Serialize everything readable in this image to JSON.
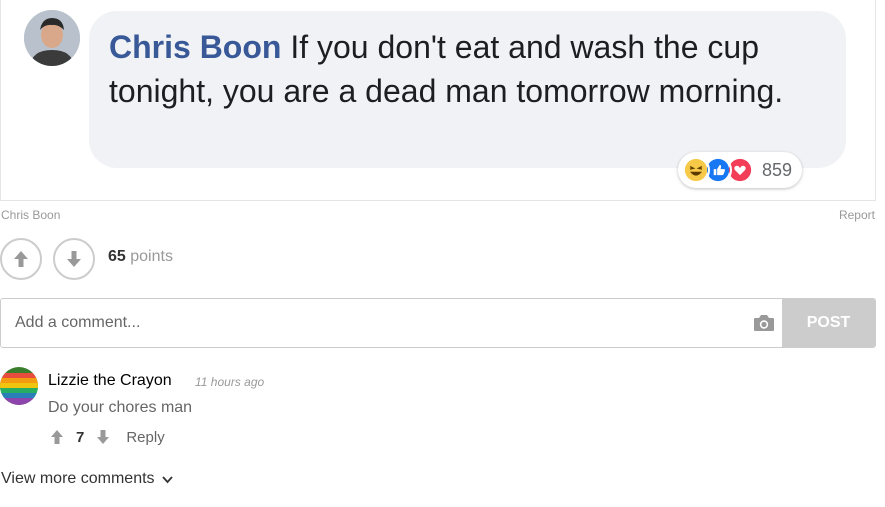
{
  "post_image": {
    "author": "Chris Boon",
    "message": "If you don't eat and wash the cup tonight, you are a dead man tomorrow morning.",
    "reaction_count": "859",
    "reactions": [
      "haha-icon",
      "like-icon",
      "love-icon"
    ]
  },
  "meta": {
    "author": "Chris Boon",
    "report": "Report"
  },
  "votes": {
    "points_value": "65",
    "points_label": "points"
  },
  "comment_form": {
    "placeholder": "Add a comment...",
    "post_label": "POST"
  },
  "comment": {
    "author": "Lizzie the Crayon",
    "time": "11 hours ago",
    "text": "Do your chores man",
    "score": "7",
    "reply_label": "Reply"
  },
  "view_more_label": "View more comments",
  "colors": {
    "author_link": "#385898",
    "bubble_bg": "#f0f2f5",
    "post_button": "#cccccc"
  }
}
